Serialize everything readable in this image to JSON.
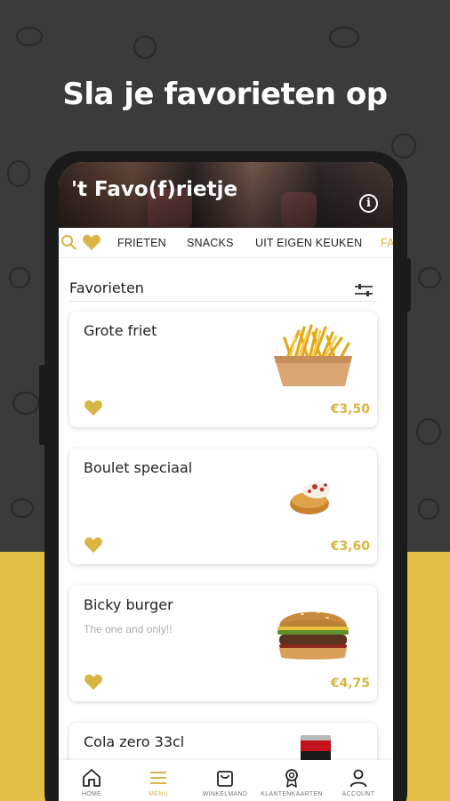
{
  "headline": "Sla je favorieten op",
  "app": {
    "restaurant_name": "'t Favo(f)rietje",
    "info_icon": "info-icon",
    "info_glyph": "i"
  },
  "tabs": [
    {
      "label": "FRIETEN"
    },
    {
      "label": "SNACKS"
    },
    {
      "label": "UIT EIGEN KEUKEN"
    },
    {
      "label": "FA"
    }
  ],
  "section": {
    "title": "Favorieten",
    "filter_icon": "sliders-icon"
  },
  "products": [
    {
      "name": "Grote friet",
      "description": "",
      "price": "€3,50",
      "image": "fries-image",
      "favorite": true
    },
    {
      "name": "Boulet speciaal",
      "description": "",
      "price": "€3,60",
      "image": "boulet-image",
      "favorite": true
    },
    {
      "name": "Bicky burger",
      "description": "The one and only!!",
      "price": "€4,75",
      "image": "burger-image",
      "favorite": true
    },
    {
      "name": "Cola zero 33cl",
      "description": "",
      "price": "",
      "image": "cola-can-image",
      "favorite": true
    }
  ],
  "bottom_nav": [
    {
      "label": "HOME",
      "icon": "home-icon"
    },
    {
      "label": "MENU",
      "icon": "menu-icon",
      "active": true
    },
    {
      "label": "WINKELMAND",
      "icon": "basket-icon"
    },
    {
      "label": "KLANTENKAARTEN",
      "icon": "badge-icon"
    },
    {
      "label": "ACCOUNT",
      "icon": "user-icon"
    }
  ],
  "colors": {
    "accent": "#d8b545",
    "background_dark": "#3b3b3b",
    "background_yellow": "#e3bd45"
  }
}
